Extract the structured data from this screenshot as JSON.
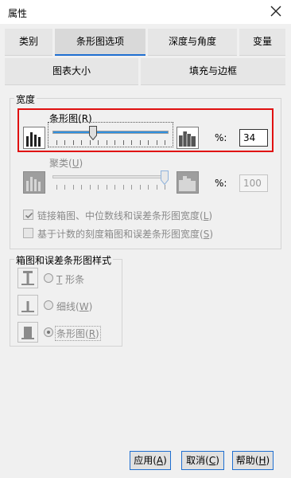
{
  "window": {
    "title": "属性"
  },
  "tabs_row1": [
    {
      "label": "类别",
      "active": false
    },
    {
      "label": "条形图选项",
      "active": true
    },
    {
      "label": "深度与角度",
      "active": false
    },
    {
      "label": "变量",
      "active": false
    }
  ],
  "tabs_row2": [
    {
      "label": "图表大小"
    },
    {
      "label": "填充与边框"
    }
  ],
  "width_group": {
    "legend": "宽度",
    "bar": {
      "label": "条形图",
      "accel": "(R)",
      "percent_label": "%:",
      "value": "34",
      "slider_fraction": 0.34
    },
    "cluster": {
      "label": "聚类",
      "accel_open": "(",
      "accel_key": "U",
      "accel_close": ")",
      "percent_label": "%:",
      "value": "100",
      "slider_fraction": 1.0,
      "disabled": true
    },
    "link_checkbox": {
      "text": "链接箱图、中位数线和误差条形图宽度",
      "accel_open": "(",
      "accel_key": "L",
      "accel_close": ")",
      "checked": true,
      "disabled": true
    },
    "count_checkbox": {
      "text": "基于计数的刻度箱图和误差条形图宽度",
      "accel_open": "(",
      "accel_key": "S",
      "accel_close": ")",
      "checked": false,
      "disabled": true
    }
  },
  "style_group": {
    "legend": "箱图和误差条形图样式",
    "options": [
      {
        "text": "形条",
        "accel_key": "T",
        "selected": false
      },
      {
        "text": "细线",
        "accel_open": "(",
        "accel_key": "W",
        "accel_close": ")",
        "selected": false
      },
      {
        "text": "条形图",
        "accel_open": "(",
        "accel_key": "R",
        "accel_close": ")",
        "selected": true
      }
    ]
  },
  "buttons": {
    "apply": {
      "text": "应用",
      "accel_open": "(",
      "accel_key": "A",
      "accel_close": ")"
    },
    "cancel": {
      "text": "取消",
      "accel_open": "(",
      "accel_key": "C",
      "accel_close": ")"
    },
    "help": {
      "text": "帮助",
      "accel_open": "(",
      "accel_key": "H",
      "accel_close": ")"
    }
  },
  "colors": {
    "accent": "#1f6fd1",
    "highlight_box": "#e01010",
    "slider_fill": "#2f8fdf"
  }
}
